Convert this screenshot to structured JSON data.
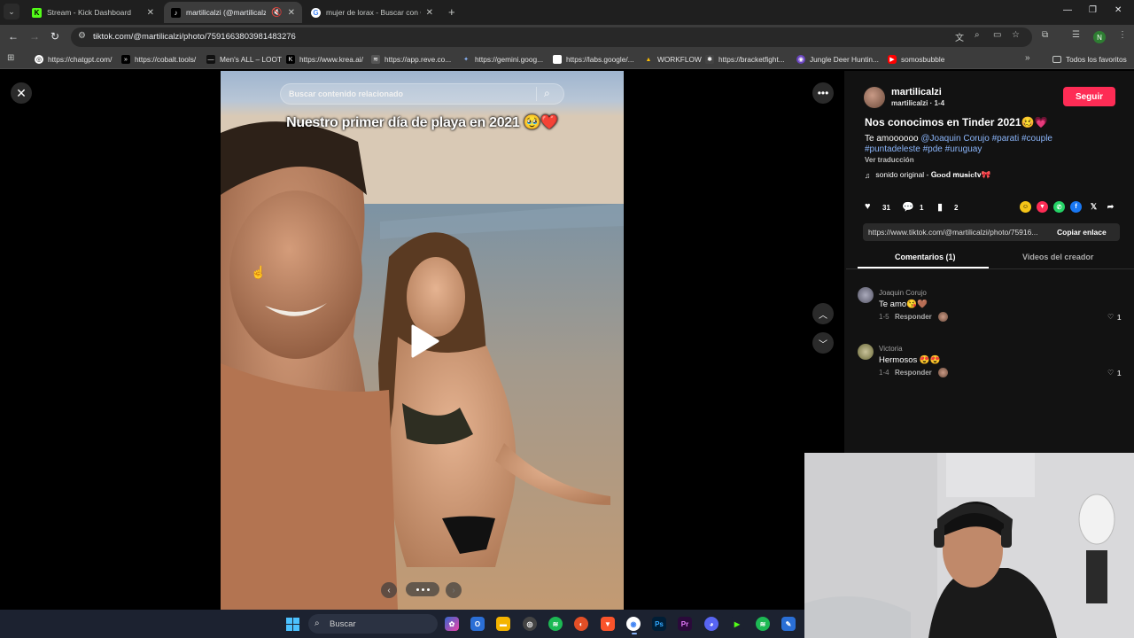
{
  "browser": {
    "tabs": [
      {
        "title": "Stream - Kick Dashboard",
        "favicon": "kick-icon",
        "active": false
      },
      {
        "title": "martilicalzi (@martilicalzi) |",
        "favicon": "tiktok-icon",
        "active": true
      },
      {
        "title": "mujer de lorax - Buscar con Go",
        "favicon": "google-icon",
        "active": false
      }
    ],
    "url": "tiktok.com/@martilicalzi/photo/7591663803981483276",
    "bookmarks": [
      "https://chatgpt.com/",
      "https://cobalt.tools/",
      "Men's ALL – LOOT",
      "https://www.krea.ai/",
      "https://app.reve.co...",
      "https://gemini.goog...",
      "https://labs.google/...",
      "WORKFLOW",
      "https://bracketfight...",
      "Jungle Deer Huntin...",
      "somosbubble"
    ],
    "all_bookmarks": "Todos los favoritos",
    "profile_initial": "N"
  },
  "viewer": {
    "search_placeholder": "Buscar contenido relacionado",
    "photo_caption": "Nuestro primer día de playa en 2021 🥹❤️",
    "carousel_total": 3
  },
  "side": {
    "username": "martilicalzi",
    "meta": "martilicalzi · 1-4",
    "follow_label": "Seguir",
    "title": "Nos conocimos en Tinder 2021🥴💗",
    "desc_prefix": "Te amoooooo",
    "desc_mention": "@Joaquin Corujo",
    "desc_tags_1": "#parati #couple",
    "desc_tags_2": "#puntadeleste #pde #uruguay",
    "see_translation": "Ver traducción",
    "sound": "sonido original - 𝐆𝐨𝐨𝐝 𝐦𝐮𝐬𝐢𝐜𝐭𝐯🎀",
    "likes": "31",
    "comments_count": "1",
    "saves": "2",
    "link": "https://www.tiktok.com/@martilicalzi/photo/75916...",
    "copy_link": "Copiar enlace",
    "tab_comments": "Comentarios (1)",
    "tab_videos": "Videos del creador",
    "comments": [
      {
        "user": "Joaquin Corujo",
        "text": "Te amo😘🤎",
        "date": "1-5",
        "reply": "Responder",
        "likes": "1"
      },
      {
        "user": "Victoria",
        "text": "Hermosos 😍😍",
        "date": "1-4",
        "reply": "Responder",
        "likes": "1"
      }
    ]
  },
  "taskbar": {
    "search_label": "Buscar"
  },
  "colors": {
    "tiktok_red": "#fe2c55",
    "link_blue": "#8ab4f8",
    "panel_bg": "#121212",
    "chrome_toolbar": "#3c3c3c"
  }
}
